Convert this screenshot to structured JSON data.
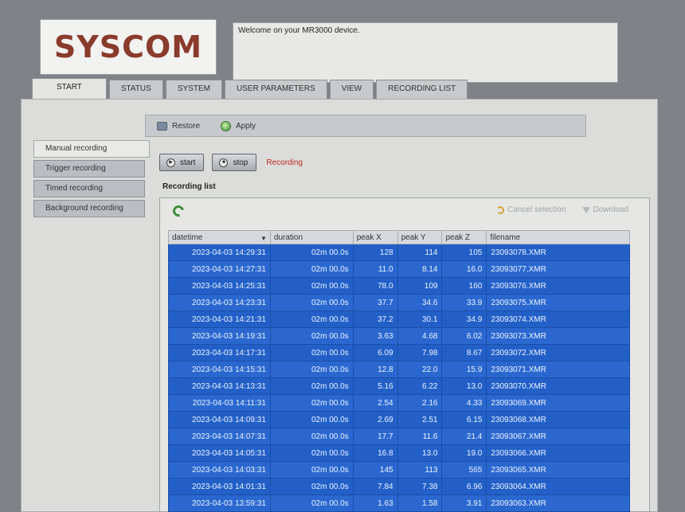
{
  "brand": {
    "logo": "SYSCOM"
  },
  "welcome": {
    "message": "Welcome on your MR3000 device."
  },
  "tabs": [
    {
      "label": "START"
    },
    {
      "label": "STATUS"
    },
    {
      "label": "SYSTEM"
    },
    {
      "label": "USER PARAMETERS"
    },
    {
      "label": "VIEW"
    },
    {
      "label": "RECORDING LIST"
    }
  ],
  "toolbar": {
    "restore_label": "Restore",
    "apply_label": "Apply"
  },
  "sidenav": [
    {
      "label": "Manual recording"
    },
    {
      "label": "Trigger recording"
    },
    {
      "label": "Timed recording"
    },
    {
      "label": "Background recording"
    }
  ],
  "controls": {
    "start_label": "start",
    "stop_label": "stop",
    "status": "Recording",
    "status_color": "#c0271d"
  },
  "recording_list": {
    "title": "Recording list",
    "cancel_label": "Cancel selection",
    "download_label": "Download",
    "columns": [
      "datetime",
      "duration",
      "peak X",
      "peak Y",
      "peak Z",
      "filename"
    ],
    "rows": [
      [
        "2023-04-03 14:29:31",
        "02m 00.0s",
        "128",
        "114",
        "105",
        "23093078.XMR"
      ],
      [
        "2023-04-03 14:27:31",
        "02m 00.0s",
        "11.0",
        "8.14",
        "16.0",
        "23093077.XMR"
      ],
      [
        "2023-04-03 14:25:31",
        "02m 00.0s",
        "78.0",
        "109",
        "160",
        "23093076.XMR"
      ],
      [
        "2023-04-03 14:23:31",
        "02m 00.0s",
        "37.7",
        "34.6",
        "33.9",
        "23093075.XMR"
      ],
      [
        "2023-04-03 14:21:31",
        "02m 00.0s",
        "37.2",
        "30.1",
        "34.9",
        "23093074.XMR"
      ],
      [
        "2023-04-03 14:19:31",
        "02m 00.0s",
        "3.63",
        "4.68",
        "6.02",
        "23093073.XMR"
      ],
      [
        "2023-04-03 14:17:31",
        "02m 00.0s",
        "6.09",
        "7.98",
        "8.67",
        "23093072.XMR"
      ],
      [
        "2023-04-03 14:15:31",
        "02m 00.0s",
        "12.8",
        "22.0",
        "15.9",
        "23093071.XMR"
      ],
      [
        "2023-04-03 14:13:31",
        "02m 00.0s",
        "5.16",
        "6.22",
        "13.0",
        "23093070.XMR"
      ],
      [
        "2023-04-03 14:11:31",
        "02m 00.0s",
        "2.54",
        "2.16",
        "4.33",
        "23093069.XMR"
      ],
      [
        "2023-04-03 14:09:31",
        "02m 00.0s",
        "2.69",
        "2.51",
        "6.15",
        "23093068.XMR"
      ],
      [
        "2023-04-03 14:07:31",
        "02m 00.0s",
        "17.7",
        "11.6",
        "21.4",
        "23093067.XMR"
      ],
      [
        "2023-04-03 14:05:31",
        "02m 00.0s",
        "16.8",
        "13.0",
        "19.0",
        "23093066.XMR"
      ],
      [
        "2023-04-03 14:03:31",
        "02m 00.0s",
        "145",
        "113",
        "565",
        "23093065.XMR"
      ],
      [
        "2023-04-03 14:01:31",
        "02m 00.0s",
        "7.84",
        "7.38",
        "6.96",
        "23093064.XMR"
      ],
      [
        "2023-04-03 13:59:31",
        "02m 00.0s",
        "1.63",
        "1.58",
        "3.91",
        "23093063.XMR"
      ]
    ]
  }
}
